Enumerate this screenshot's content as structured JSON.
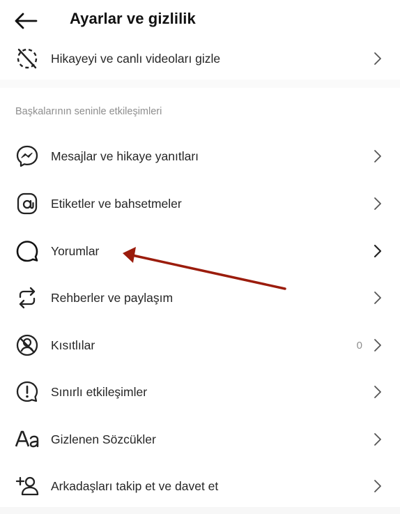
{
  "header": {
    "title": "Ayarlar ve gizlilik",
    "back_icon": "arrow-left-icon"
  },
  "top_item": {
    "label": "Hikayeyi ve canlı videoları gizle",
    "icon": "hide-story-icon"
  },
  "section": {
    "title": "Başkalarının seninle etkileşimleri",
    "items": [
      {
        "label": "Mesajlar ve hikaye yanıtları",
        "icon": "messenger-icon"
      },
      {
        "label": "Etiketler ve bahsetmeler",
        "icon": "at-sign-icon"
      },
      {
        "label": "Yorumlar",
        "icon": "comment-icon"
      },
      {
        "label": "Rehberler ve paylaşım",
        "icon": "share-arrows-icon"
      },
      {
        "label": "Kısıtlılar",
        "icon": "restricted-icon",
        "count": "0"
      },
      {
        "label": "Sınırlı etkileşimler",
        "icon": "alert-circle-icon"
      },
      {
        "label": "Gizlenen Sözcükler",
        "icon": "text-aa-icon"
      },
      {
        "label": "Arkadaşları takip et ve davet et",
        "icon": "add-person-icon"
      }
    ]
  },
  "annotation": {
    "arrow_color": "#9b1c0c",
    "points_to": "Yorumlar"
  }
}
